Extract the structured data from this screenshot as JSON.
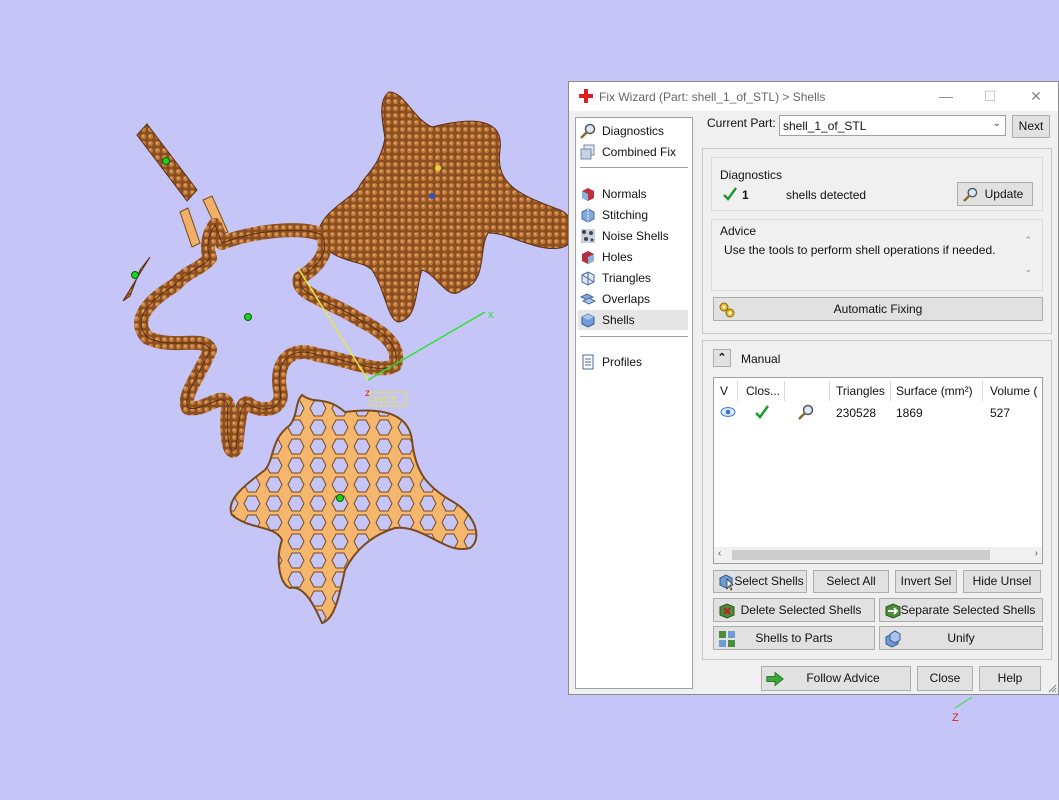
{
  "window": {
    "title": "Fix Wizard (Part: shell_1_of_STL) > Shells",
    "controls": [
      "—",
      "☐",
      "✕"
    ]
  },
  "nav": {
    "items": [
      {
        "label": "Diagnostics",
        "icon": "magnifier-icon"
      },
      {
        "label": "Combined Fix",
        "icon": "stack-icon"
      },
      {
        "label": "Normals",
        "icon": "normals-cube-icon"
      },
      {
        "label": "Stitching",
        "icon": "stitching-icon"
      },
      {
        "label": "Noise Shells",
        "icon": "noise-shells-icon"
      },
      {
        "label": "Holes",
        "icon": "holes-icon"
      },
      {
        "label": "Triangles",
        "icon": "triangles-icon"
      },
      {
        "label": "Overlaps",
        "icon": "overlaps-icon"
      },
      {
        "label": "Shells",
        "icon": "shells-icon"
      },
      {
        "label": "Profiles",
        "icon": "document-icon"
      }
    ],
    "active": "Shells"
  },
  "current_part": {
    "label": "Current Part:",
    "value": "shell_1_of_STL",
    "next_label": "Next"
  },
  "diagnostics": {
    "title": "Diagnostics",
    "count": "1",
    "status_text": "shells detected",
    "update_label": "Update"
  },
  "advice": {
    "title": "Advice",
    "text": "Use the tools to perform shell operations if needed."
  },
  "automatic_fixing_label": "Automatic Fixing",
  "manual": {
    "title": "Manual",
    "columns": [
      "V",
      "Clos...",
      "",
      "Triangles",
      "Surface (mm²)",
      "Volume ("
    ],
    "rows": [
      {
        "triangles": "230528",
        "surface": "1869",
        "volume": "527"
      }
    ],
    "buttons": {
      "select_shells": "Select Shells",
      "select_all": "Select All",
      "invert_sel": "Invert Sel",
      "hide_unsel": "Hide Unsel",
      "delete_selected": "Delete Selected Shells",
      "separate_selected": "Separate Selected Shells",
      "shells_to_parts": "Shells to Parts",
      "unify": "Unify"
    }
  },
  "footer": {
    "follow_advice": "Follow Advice",
    "close": "Close",
    "help": "Help"
  },
  "viewport": {
    "axis_x": "x",
    "axis_z": "z",
    "wcs": "WCS",
    "axis_z2": "Z"
  },
  "colors": {
    "viewport_bg": "#c5c5f8",
    "part_brown": "#9a5a28",
    "part_orange": "#f5b66e",
    "check_green": "#1a9a30",
    "axis_green": "#30e030",
    "axis_yellow": "#e8e840"
  }
}
